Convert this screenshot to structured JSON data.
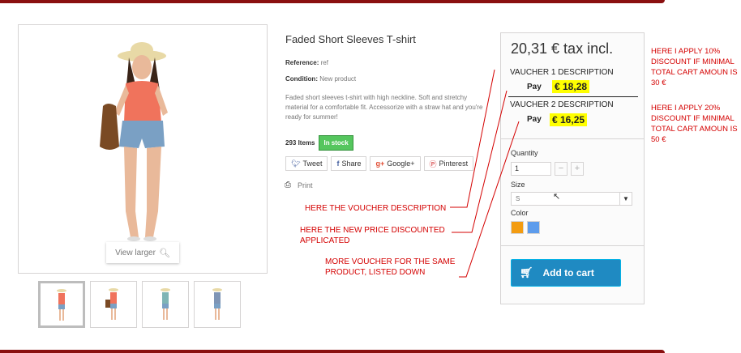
{
  "product": {
    "title": "Faded Short Sleeves T-shirt",
    "reference_label": "Reference:",
    "reference_value": "ref",
    "condition_label": "Condition:",
    "condition_value": "New product",
    "description": "Faded short sleeves t-shirt with high neckline. Soft and stretchy material for a comfortable fit. Accessorize with a straw hat and you're ready for summer!",
    "items_count": "293 Items",
    "stock_status": "In stock",
    "view_larger": "View larger",
    "thumbnail_count": 4
  },
  "share": {
    "tweet": "Tweet",
    "share": "Share",
    "google": "Google+",
    "pinterest": "Pinterest",
    "print": "Print"
  },
  "buy_box": {
    "price": "20,31 € tax incl.",
    "voucher1_description": "VAUCHER 1 DESCRIPTION",
    "voucher1_pay_label": "Pay",
    "voucher1_price": "€ 18,28",
    "voucher2_description": "VAUCHER 2 DESCRIPTION",
    "voucher2_pay_label": "Pay",
    "voucher2_price": "€ 16,25",
    "quantity_label": "Quantity",
    "quantity_value": "1",
    "size_label": "Size",
    "size_value": "S",
    "color_label": "Color",
    "colors": [
      "#f39c11",
      "#5d9cec"
    ],
    "add_to_cart": "Add to cart"
  },
  "annotations": {
    "voucher_description": "HERE THE VOUCHER DESCRIPTION",
    "new_price": "HERE THE NEW PRICE DISCOUNTED APPLICATED",
    "more_vouchers": "MORE VOUCHER FOR THE SAME PRODUCT, LISTED DOWN",
    "discount_10": "HERE I APPLY 10% DISCOUNT IF MINIMAL TOTAL CART AMOUN IS 30 €",
    "discount_20": "HERE I APPLY 20% DISCOUNT IF MINIMAL TOTAL CART AMOUN IS 50 €"
  },
  "colors": {
    "accent_blue": "#1f8ac2",
    "stock_green": "#55c65e",
    "annotation_red": "#d40000",
    "highlight_yellow": "#ffff00"
  }
}
